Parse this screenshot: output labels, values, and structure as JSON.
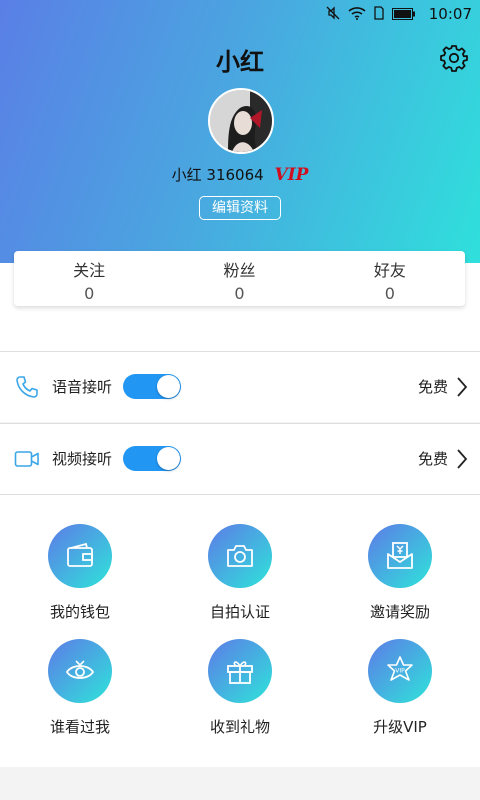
{
  "status_bar": {
    "time": "10:07"
  },
  "header": {
    "title": "小红",
    "username": "小红",
    "user_id": "316064",
    "vip_badge": "VIP",
    "edit_label": "编辑资料"
  },
  "stats": [
    {
      "label": "关注",
      "value": "0"
    },
    {
      "label": "粉丝",
      "value": "0"
    },
    {
      "label": "好友",
      "value": "0"
    }
  ],
  "settings_rows": [
    {
      "label": "语音接听",
      "value": "免费",
      "enabled": true,
      "icon": "phone-icon"
    },
    {
      "label": "视频接听",
      "value": "免费",
      "enabled": true,
      "icon": "video-icon"
    }
  ],
  "grid": [
    {
      "label": "我的钱包",
      "icon": "wallet-icon"
    },
    {
      "label": "自拍认证",
      "icon": "camera-icon"
    },
    {
      "label": "邀请奖励",
      "icon": "reward-icon"
    },
    {
      "label": "谁看过我",
      "icon": "eye-icon"
    },
    {
      "label": "收到礼物",
      "icon": "gift-icon"
    },
    {
      "label": "升级VIP",
      "icon": "vip-star-icon"
    }
  ],
  "colors": {
    "gradient_start": "#5a7fe6",
    "gradient_end": "#2fe0dc",
    "toggle_on": "#2196f3",
    "vip_red": "#d10e1d"
  }
}
